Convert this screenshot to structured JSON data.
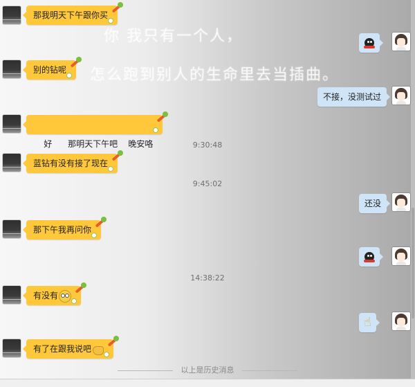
{
  "watermark": {
    "line1": "你     我只有一个人，",
    "line2": "怎么跑到别人的生命里去当插曲。"
  },
  "messages": [
    {
      "side": "left",
      "text": "那我明天下午跟你买"
    },
    {
      "side": "right",
      "emoji": "penguin-icon"
    },
    {
      "side": "left",
      "text": "别的钻呢"
    },
    {
      "side": "right",
      "text": "不接，没测试过"
    },
    {
      "side": "left",
      "text": "好      那明天下午吧    晚安咯"
    },
    {
      "side": "time",
      "text": "9:30:48"
    },
    {
      "side": "left",
      "text": "蓝钻有没有接了现在"
    },
    {
      "side": "time",
      "text": "9:45:02"
    },
    {
      "side": "right",
      "text": "还没"
    },
    {
      "side": "left",
      "text": "那下午我再问你"
    },
    {
      "side": "right",
      "emoji": "penguin-icon"
    },
    {
      "side": "time",
      "text": "14:38:22"
    },
    {
      "side": "left",
      "text": "有没有",
      "emoji": "dizzy-face-icon"
    },
    {
      "side": "right",
      "emoji": "pointing-hand-icon"
    },
    {
      "side": "left",
      "text": "有了在跟我说吧",
      "emoji": "handshake-icon"
    }
  ],
  "history_label": "以上是历史消息",
  "colors": {
    "left_bubble": "#ffc83a",
    "right_bubble": "#cfe4f7",
    "timestamp": "#6f6f6f"
  }
}
